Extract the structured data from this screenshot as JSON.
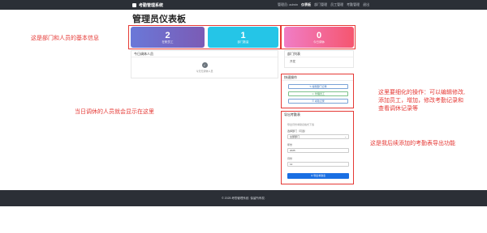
{
  "navbar": {
    "brand": "考勤管理系统",
    "items": [
      "管理员: admin",
      "仪表板",
      "部门管理",
      "员工管理",
      "考勤管理",
      "退出"
    ],
    "active_index": 1
  },
  "page_title": "管理员仪表板",
  "cards": [
    {
      "value": "2",
      "label": "在职员工"
    },
    {
      "value": "1",
      "label": "部门数量"
    },
    {
      "value": "0",
      "label": "今日调休"
    }
  ],
  "leave_panel": {
    "title": "今日调休人员",
    "empty_text": "今天无调休人员"
  },
  "dept_panel": {
    "title": "部门列表",
    "items": [
      "开发"
    ]
  },
  "quick_panel": {
    "title": "快速操作",
    "buttons": [
      "编辑部门记录",
      "管理员工",
      "考勤记录"
    ]
  },
  "export_panel": {
    "title": "导出考勤表",
    "subtitle": "导出月份考勤表格式下载",
    "dept_label": "选择部门（可选）",
    "dept_value": "全部部门",
    "year_label": "年份",
    "year_value": "2025",
    "month_label": "月份",
    "month_value": "12",
    "button": "导出考勤表"
  },
  "annotations": {
    "a1": "这是部门和人员的基本信息",
    "a2": "当日调休的人员就会显示在这里",
    "a3_line1": "这里要细化的操作：可以编辑修改,",
    "a3_line2": "添加员工，增加，修改考勤记录和",
    "a3_line3": "查看调休记录等",
    "a4": "这是我后续添加的考勤表导出功能"
  },
  "footer": "© 2025 考勤管理系统. 保留所有权.",
  "colors": {
    "navbar": "#2b2f36",
    "card1": "#6a78d8",
    "card2": "#25c5e7",
    "card3": "#f5566f",
    "annotation": "#e53935",
    "primary_button": "#1a6fe3"
  }
}
